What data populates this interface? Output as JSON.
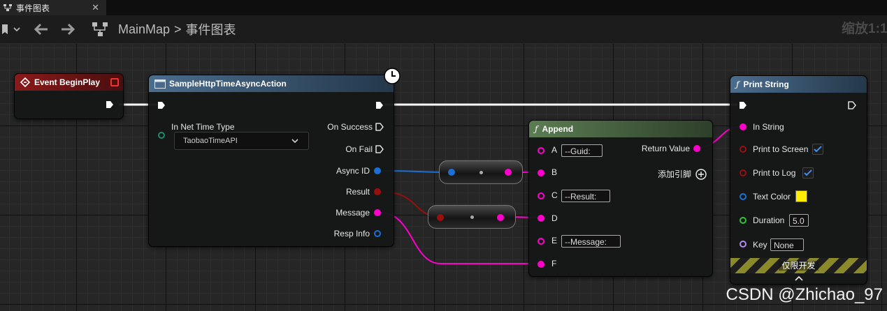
{
  "tab": {
    "title": "事件图表",
    "close": "✕"
  },
  "breadcrumb": {
    "map": "MainMap",
    "separator": ">",
    "graph": "事件图表"
  },
  "zoom_label": "缩放1:1",
  "nodes": {
    "begin_play": {
      "title": "Event BeginPlay"
    },
    "async_action": {
      "title": "SampleHttpTimeAsyncAction",
      "in_net_time_type_label": "In Net Time Type",
      "in_net_time_type_value": "TaobaoTimeAPI",
      "on_success": "On Success",
      "on_fail": "On Fail",
      "async_id": "Async ID",
      "result": "Result",
      "message": "Message",
      "resp_info": "Resp Info"
    },
    "append": {
      "title": "Append",
      "pin_a": "A",
      "a_value": "--Guid:",
      "pin_b": "B",
      "pin_c": "C",
      "c_value": "--Result:",
      "pin_d": "D",
      "pin_e": "E",
      "e_value": "--Message:",
      "pin_f": "F",
      "return_value": "Return Value",
      "add_pin": "添加引脚"
    },
    "print_string": {
      "title": "Print String",
      "in_string": "In String",
      "print_to_screen": "Print to Screen",
      "print_to_screen_checked": true,
      "print_to_log": "Print to Log",
      "print_to_log_checked": true,
      "text_color": "Text Color",
      "text_color_value": "#ffee00",
      "duration": "Duration",
      "duration_value": "5.0",
      "key": "Key",
      "key_value": "None",
      "dev_only": "仅限开发"
    }
  },
  "colors": {
    "exec": "#ffffff",
    "string_pin": "#ff00cc",
    "int_pin": "#1b7be8",
    "enum_pin": "#9b0e0e",
    "struct_pin": "#1b7be8",
    "event_header": "#7a1515",
    "function_header": "#3d5a78",
    "append_header": "#4e6b45"
  },
  "watermark": "CSDN @Zhichao_97"
}
